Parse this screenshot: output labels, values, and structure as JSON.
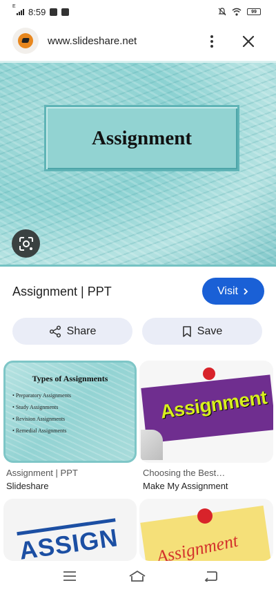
{
  "status_bar": {
    "time": "8:59",
    "network_label": "E",
    "battery_level": "99"
  },
  "browser": {
    "url": "www.slideshare.net",
    "favicon": "slideshare-icon"
  },
  "hero": {
    "slide_title": "Assignment"
  },
  "result": {
    "title": "Assignment | PPT",
    "visit_label": "Visit",
    "share_label": "Share",
    "save_label": "Save"
  },
  "related": [
    {
      "slide_title": "Types of Assignments",
      "slide_items": [
        "Preparatory Assignments",
        "Study Assignments",
        "Revision Assignments",
        "Remedial Assignments"
      ],
      "caption": "Assignment | PPT",
      "site": "Slideshare"
    },
    {
      "image_text": "Assignment",
      "caption": "Choosing the Best…",
      "site": "Make My Assignment"
    },
    {
      "image_text": "ASSIGN"
    },
    {
      "image_text": "Assignment"
    }
  ],
  "colors": {
    "accent": "#1a60d6",
    "pill_bg": "#eaedf7",
    "teal": "#92d3d2"
  }
}
